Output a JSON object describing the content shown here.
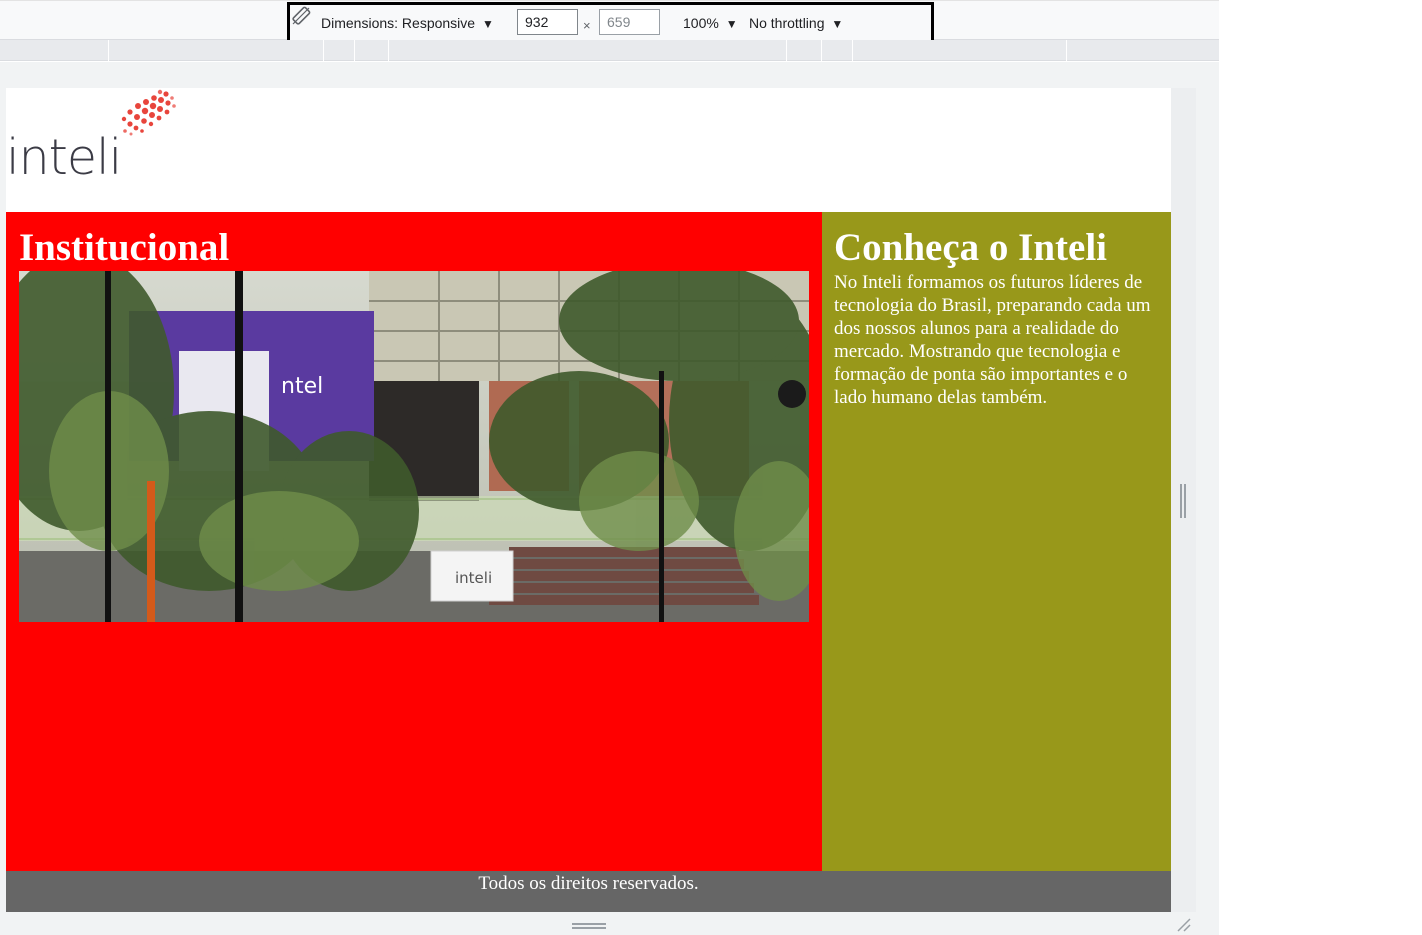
{
  "devtools": {
    "dimensions_label": "Dimensions: Responsive",
    "width_value": "932",
    "height_value": "659",
    "times_sign": "×",
    "zoom_label": "100%",
    "throttling_label": "No throttling",
    "dropdown_arrow": "▼",
    "rotate_icon": "rotate-icon"
  },
  "page": {
    "logo_text": "inteli",
    "institucional": {
      "title": "Institucional",
      "background": "#ff0000",
      "photo_sign_text": "inteli",
      "photo_banner_text": "ntel"
    },
    "conheca": {
      "title": "Conheça o Inteli",
      "text": "No Inteli formamos os futuros líderes de tecnologia do Brasil, preparando cada um dos nossos alunos para a realidade do mercado. Mostrando que tecnologia e formação de ponta são importantes e o lado humano delas também.",
      "background": "#98981a"
    },
    "footer": {
      "text": "Todos os direitos reservados.",
      "background": "#666666"
    }
  }
}
